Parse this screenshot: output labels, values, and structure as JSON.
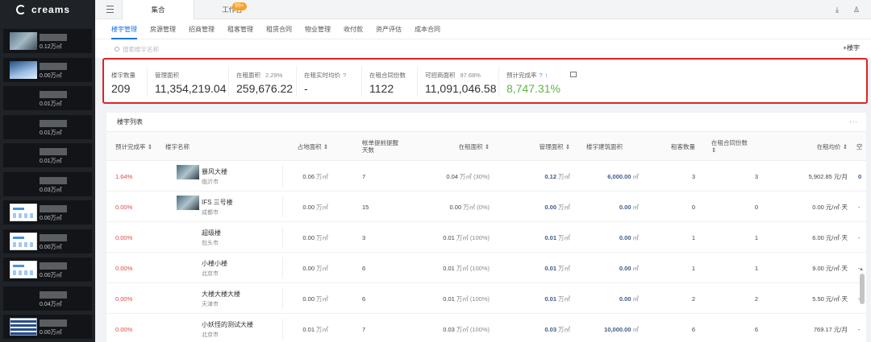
{
  "app": {
    "logo": "creams"
  },
  "sidebar": {
    "items": [
      {
        "value": "0.12万㎡",
        "thumb": "city"
      },
      {
        "value": "0.00万㎡",
        "thumb": "sky"
      },
      {
        "value": "0.01万㎡",
        "thumb": "none"
      },
      {
        "value": "0.01万㎡",
        "thumb": "none"
      },
      {
        "value": "0.01万㎡",
        "thumb": "none"
      },
      {
        "value": "0.03万㎡",
        "thumb": "none"
      },
      {
        "value": "0.00万㎡",
        "thumb": "doc"
      },
      {
        "value": "0.00万㎡",
        "thumb": "doc"
      },
      {
        "value": "0.00万㎡",
        "thumb": "doc"
      },
      {
        "value": "0.04万㎡",
        "thumb": "none"
      },
      {
        "value": "0.00万㎡",
        "thumb": "qr"
      }
    ]
  },
  "topbar": {
    "tab_active": "集合",
    "tab_work": "工作台",
    "work_badge": "99+"
  },
  "subnav": [
    "楼宇管理",
    "房源管理",
    "招商管理",
    "租客管理",
    "租赁合同",
    "物业管理",
    "收付款",
    "资产评估",
    "成本合同"
  ],
  "search": {
    "placeholder": "搜索楼宇名称",
    "add_label": "+楼宇"
  },
  "stats": [
    {
      "label": "楼宇数量",
      "value": "209"
    },
    {
      "label": "管理面积",
      "value": "11,354,219.04"
    },
    {
      "label": "在租面积",
      "pct": "2.29%",
      "value": "259,676.22"
    },
    {
      "label": "在租实时均价",
      "value": "-"
    },
    {
      "label": "在租合同份数",
      "value": "1122"
    },
    {
      "label": "可招商面积",
      "pct": "97.68%",
      "value": "11,091,046.58"
    },
    {
      "label": "预计完成率",
      "value": "8,747.31%"
    }
  ],
  "list": {
    "title": "楼宇列表",
    "more": "···",
    "headers": {
      "rate": "预计完成率 ⇕",
      "name": "楼宇名称",
      "land": "占地面积 ⇕",
      "remind": "帐单提前提醒\n天数",
      "rent_area": "在租面积 ⇕",
      "manage_area": "管理面积 ⇕",
      "build_area": "楼宇建筑面积",
      "tenants": "租客数量",
      "contracts": "在租合同份数\n⇕",
      "avg_price": "在租均价 ⇕",
      "extra": "空"
    },
    "rows": [
      {
        "rate": "1.64%",
        "name": "暴风大楼",
        "city": "临沂市",
        "thumb": true,
        "land": "0.06",
        "remind": "7",
        "rent": "0.04",
        "rent_pct": "(30%)",
        "manage": "0.12",
        "build": "6,000.00",
        "tenants": "3",
        "contracts": "3",
        "avg": "5,902.85 元/月",
        "extra": "0"
      },
      {
        "rate": "0.00%",
        "name": "IFS 三号楼",
        "city": "成都市",
        "thumb": true,
        "land": "0.00",
        "remind": "15",
        "rent": "0.00",
        "rent_pct": "(0%)",
        "manage": "0.00",
        "build": "0.00",
        "tenants": "0",
        "contracts": "0",
        "avg": "0.00 元/㎡·天",
        "extra": "-"
      },
      {
        "rate": "0.00%",
        "name": "超级楼",
        "city": "包头市",
        "thumb": false,
        "land": "0.00",
        "remind": "3",
        "rent": "0.01",
        "rent_pct": "(100%)",
        "manage": "0.01",
        "build": "0.00",
        "tenants": "1",
        "contracts": "1",
        "avg": "6.00 元/㎡·天",
        "extra": "-"
      },
      {
        "rate": "0.00%",
        "name": "小楼小楼",
        "city": "北京市",
        "thumb": false,
        "land": "0.00",
        "remind": "6",
        "rent": "0.01",
        "rent_pct": "(100%)",
        "manage": "0.01",
        "build": "0.00",
        "tenants": "1",
        "contracts": "1",
        "avg": "9.00 元/㎡·天",
        "extra": "-"
      },
      {
        "rate": "0.00%",
        "name": "大楼大楼大楼",
        "city": "天津市",
        "thumb": false,
        "land": "0.00",
        "remind": "6",
        "rent": "0.01",
        "rent_pct": "(100%)",
        "manage": "0.01",
        "build": "0.00",
        "tenants": "2",
        "contracts": "2",
        "avg": "5.50 元/㎡·天",
        "extra": "-"
      },
      {
        "rate": "0.00%",
        "name": "小妖怪的测试大楼",
        "city": "北京市",
        "thumb": false,
        "land": "0.01",
        "remind": "7",
        "rent": "0.03",
        "rent_pct": "(100%)",
        "manage": "0.03",
        "build": "10,000.00",
        "tenants": "6",
        "contracts": "6",
        "avg": "769.17 元/月",
        "extra": "-"
      }
    ]
  },
  "units": {
    "wan": "万㎡",
    "sqm": "㎡"
  }
}
